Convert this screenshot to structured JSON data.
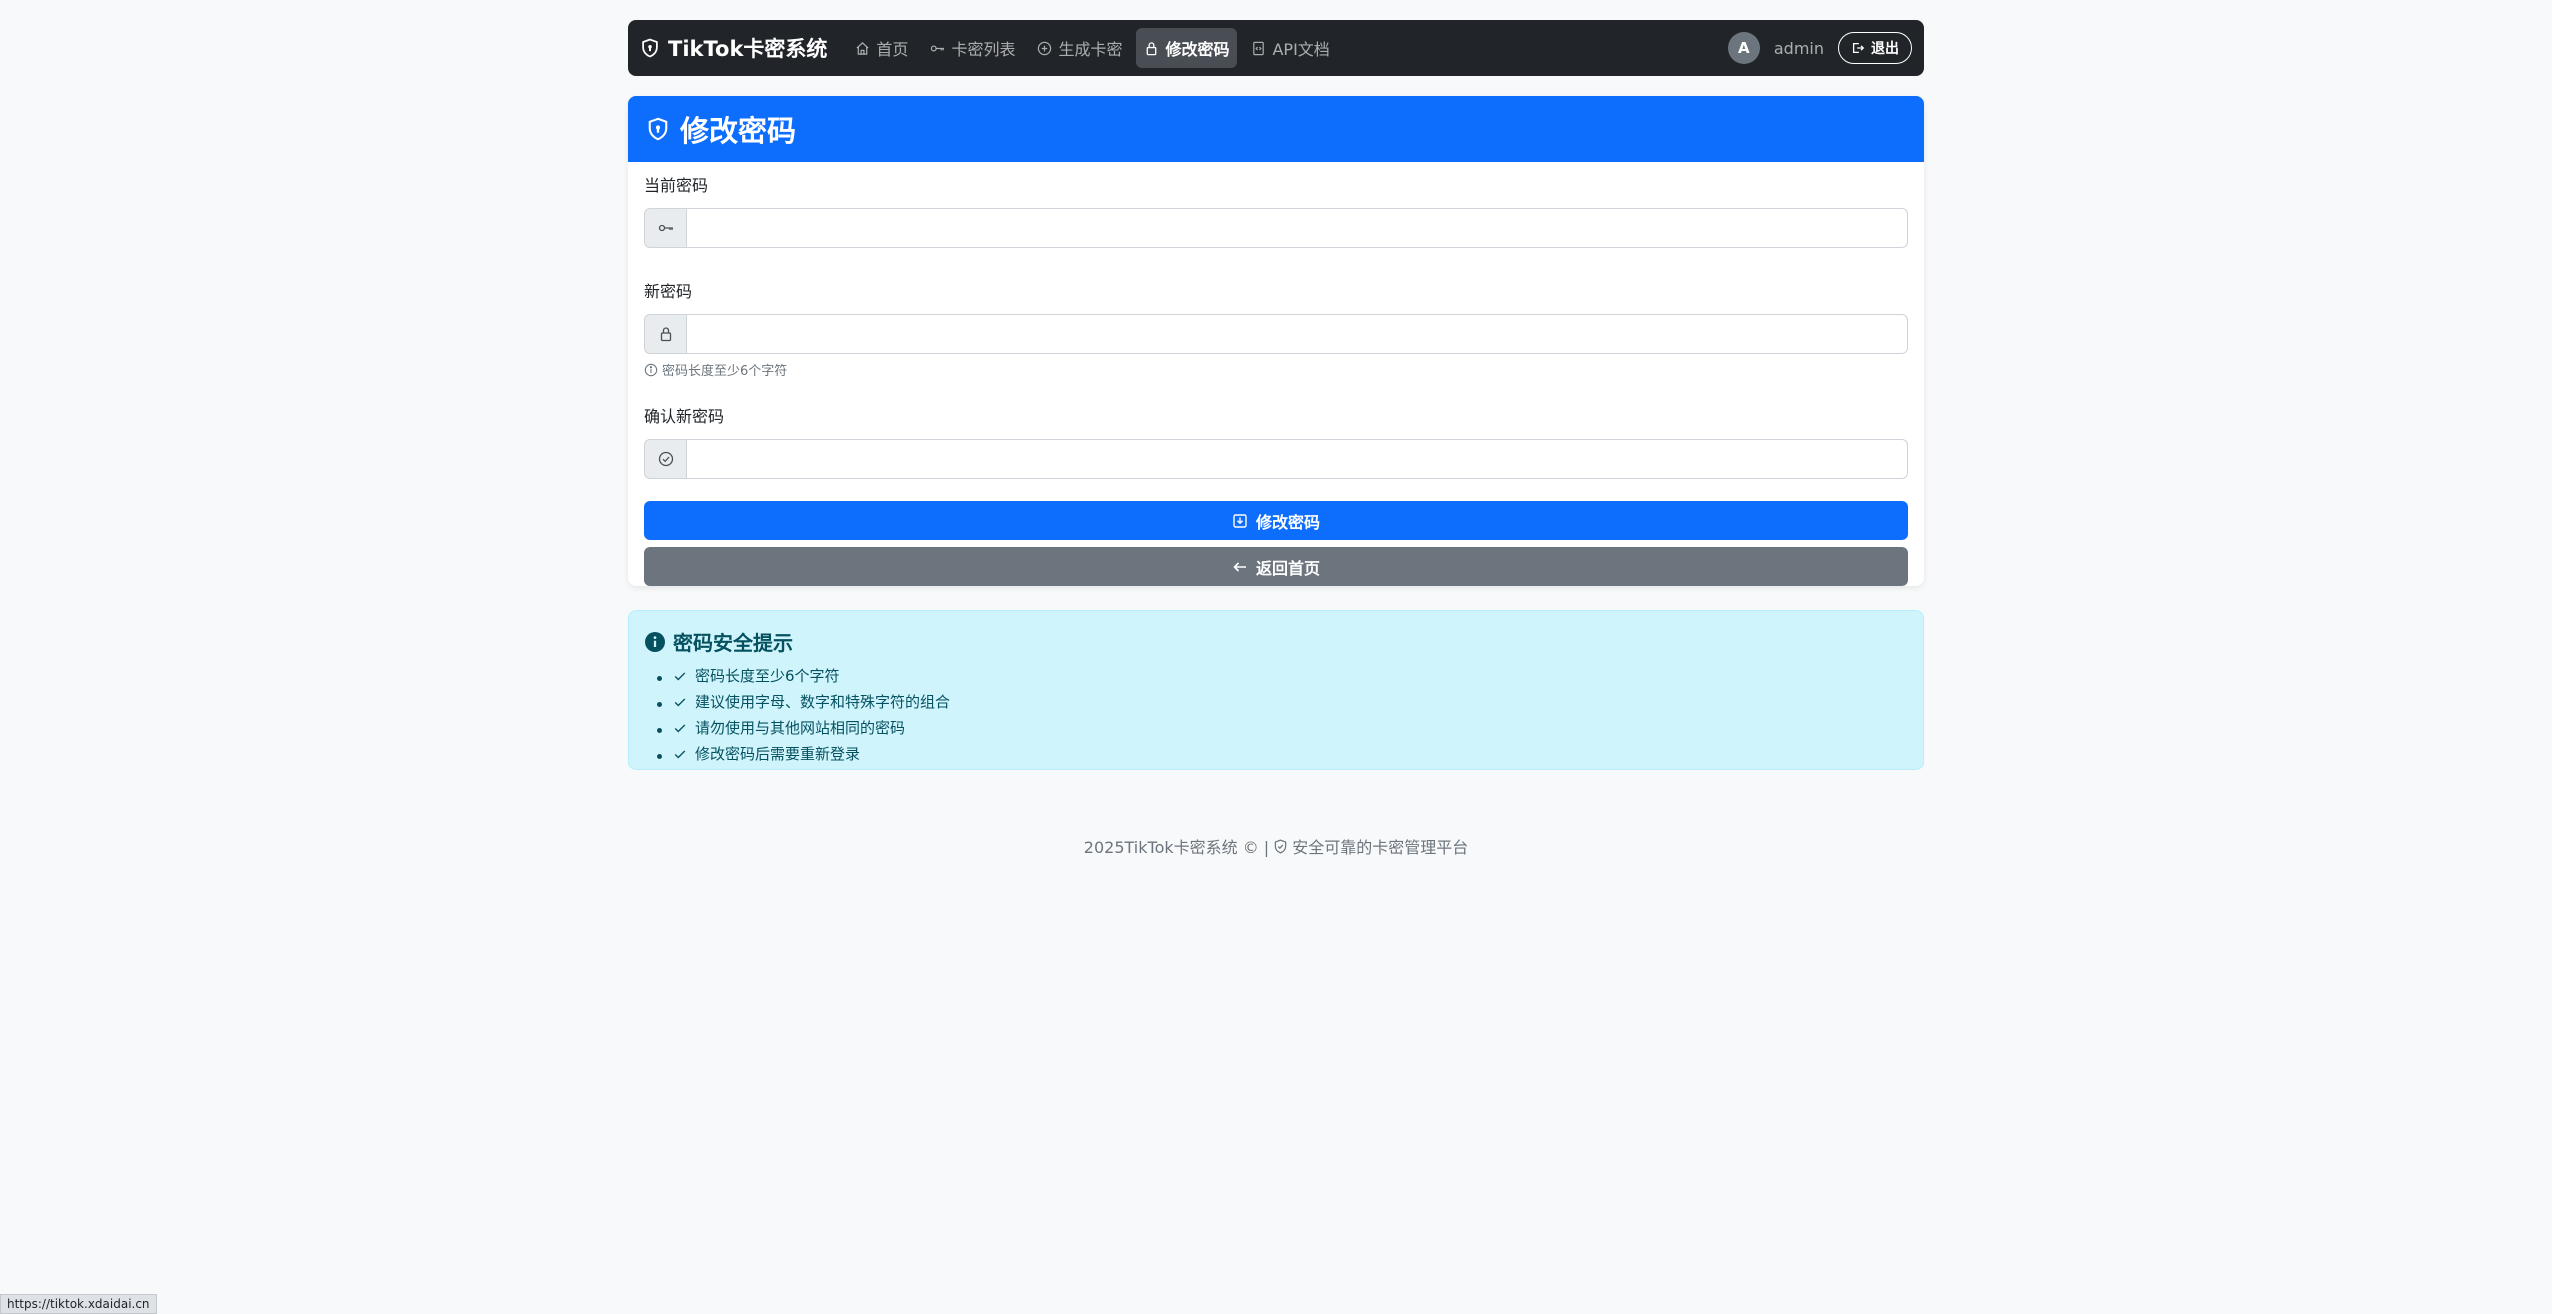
{
  "navbar": {
    "brand": "TikTok卡密系统",
    "links": [
      {
        "label": "首页",
        "icon": "house-icon"
      },
      {
        "label": "卡密列表",
        "icon": "key-icon"
      },
      {
        "label": "生成卡密",
        "icon": "plus-circle-icon"
      },
      {
        "label": "修改密码",
        "icon": "lock-icon",
        "active": true
      },
      {
        "label": "API文档",
        "icon": "file-code-icon"
      }
    ],
    "avatar_initial": "A",
    "username": "admin",
    "logout_label": "退出"
  },
  "form": {
    "title": "修改密码",
    "fields": [
      {
        "label": "当前密码",
        "value": "",
        "icon": "key-icon"
      },
      {
        "label": "新密码",
        "value": "",
        "icon": "lock-icon"
      },
      {
        "label": "确认新密码",
        "value": "",
        "icon": "check-circle-icon"
      }
    ],
    "new_password_hint": "密码长度至少6个字符",
    "submit_label": "修改密码",
    "back_label": "返回首页"
  },
  "tips": {
    "title": "密码安全提示",
    "items": [
      "密码长度至少6个字符",
      "建议使用字母、数字和特殊字符的组合",
      "请勿使用与其他网站相同的密码",
      "修改密码后需要重新登录"
    ]
  },
  "footer": {
    "copyright": "2025TikTok卡密系统 © |",
    "tagline": "安全可靠的卡密管理平台"
  },
  "status_url": "https://tiktok.xdaidai.cn",
  "colors": {
    "primary": "#0d6efd",
    "secondary": "#6c757d",
    "navbar": "#212529",
    "info_bg": "#cff4fc"
  }
}
